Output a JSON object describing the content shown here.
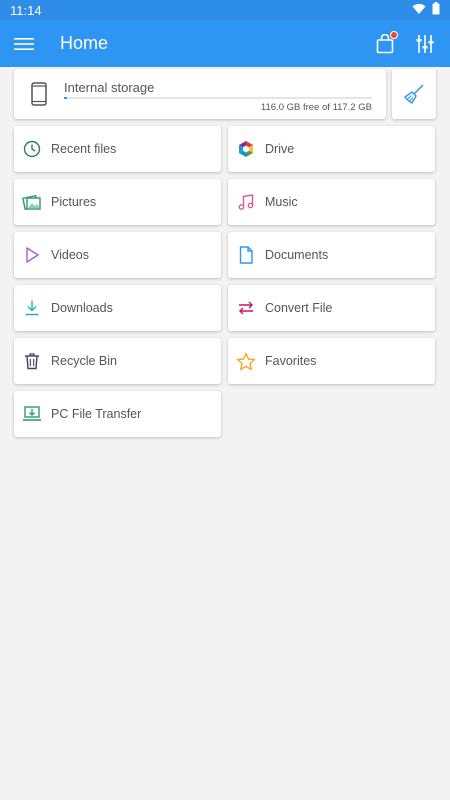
{
  "status": {
    "time": "11:14"
  },
  "appbar": {
    "title": "Home"
  },
  "storage": {
    "label": "Internal storage",
    "free_text": "116.0 GB free of 117.2 GB",
    "used_fraction": 0.01
  },
  "colors": {
    "primary": "#2f95f3",
    "status_bar": "#2d8de8",
    "badge": "#f44336"
  },
  "tiles": [
    {
      "id": "recent",
      "label": "Recent files",
      "icon": "clock-icon"
    },
    {
      "id": "drive",
      "label": "Drive",
      "icon": "drive-icon"
    },
    {
      "id": "pictures",
      "label": "Pictures",
      "icon": "pictures-icon"
    },
    {
      "id": "music",
      "label": "Music",
      "icon": "music-icon"
    },
    {
      "id": "videos",
      "label": "Videos",
      "icon": "play-icon"
    },
    {
      "id": "documents",
      "label": "Documents",
      "icon": "document-icon"
    },
    {
      "id": "downloads",
      "label": "Downloads",
      "icon": "download-icon"
    },
    {
      "id": "convert",
      "label": "Convert File",
      "icon": "convert-icon"
    },
    {
      "id": "recycle",
      "label": "Recycle Bin",
      "icon": "trash-icon"
    },
    {
      "id": "favorites",
      "label": "Favorites",
      "icon": "star-icon"
    },
    {
      "id": "pc_transfer",
      "label": "PC File Transfer",
      "icon": "pc-transfer-icon"
    }
  ]
}
